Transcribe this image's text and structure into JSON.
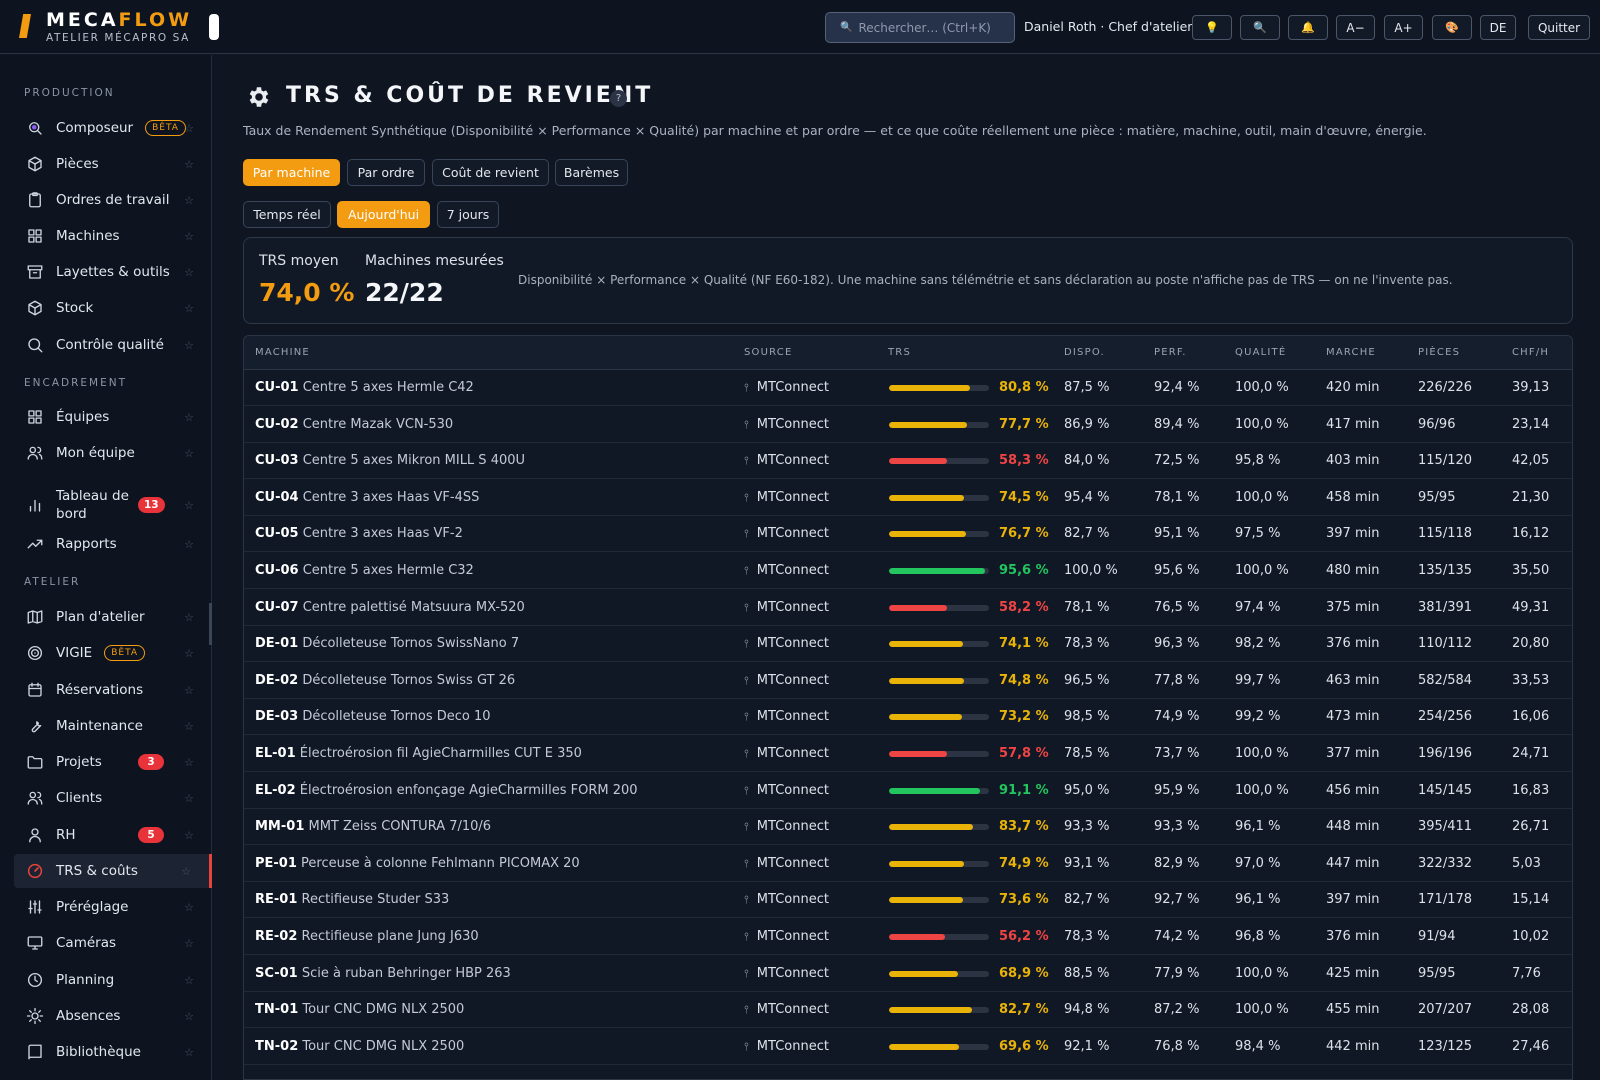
{
  "header": {
    "brand_main": "MECA",
    "brand_accent": "FLOW",
    "brand_sub": "ATELIER MÉCAPRO SA",
    "search_placeholder": "Rechercher…  (Ctrl+K)",
    "user": "Daniel Roth · Chef d'atelier",
    "buttons": [
      {
        "icon": "lightbulb-icon",
        "glyph": "💡"
      },
      {
        "icon": "search-icon",
        "glyph": "🔍"
      },
      {
        "icon": "bell-icon",
        "glyph": "🔔"
      },
      {
        "label": "A−"
      },
      {
        "label": "A+"
      },
      {
        "icon": "palette-icon",
        "glyph": "🎨"
      },
      {
        "label": "DE"
      },
      {
        "label": "Quitter"
      }
    ]
  },
  "sidebar": {
    "sections": [
      "PRODUCTION",
      "ENCADREMENT",
      "ATELIER"
    ],
    "items": [
      {
        "label": "Composeur",
        "icon": "composer-icon",
        "badge_beta": "BÊTA"
      },
      {
        "label": "Pièces",
        "icon": "cube-icon"
      },
      {
        "label": "Ordres de travail",
        "icon": "clipboard-icon"
      },
      {
        "label": "Machines",
        "icon": "grid-icon"
      },
      {
        "label": "Layettes & outils",
        "icon": "archive-icon"
      },
      {
        "label": "Stock",
        "icon": "box-icon"
      },
      {
        "label": "Contrôle qualité",
        "icon": "search-icon"
      },
      {
        "label": "Équipes",
        "icon": "grid-icon"
      },
      {
        "label": "Mon équipe",
        "icon": "users-icon"
      },
      {
        "label": "Tableau de bord",
        "icon": "bar-chart-icon",
        "badge": "13"
      },
      {
        "label": "Rapports",
        "icon": "trending-icon"
      },
      {
        "label": "Plan d'atelier",
        "icon": "map-icon"
      },
      {
        "label": "VIGIE",
        "icon": "target-icon",
        "badge_beta": "BÊTA"
      },
      {
        "label": "Réservations",
        "icon": "calendar-icon"
      },
      {
        "label": "Maintenance",
        "icon": "wrench-icon"
      },
      {
        "label": "Projets",
        "icon": "folder-icon",
        "badge": "3"
      },
      {
        "label": "Clients",
        "icon": "users-icon"
      },
      {
        "label": "RH",
        "icon": "user-icon",
        "badge": "5"
      },
      {
        "label": "TRS & coûts",
        "icon": "gauge-icon",
        "active": true
      },
      {
        "label": "Préréglage",
        "icon": "sliders-icon"
      },
      {
        "label": "Caméras",
        "icon": "monitor-icon"
      },
      {
        "label": "Planning",
        "icon": "clock-icon"
      },
      {
        "label": "Absences",
        "icon": "sun-icon"
      },
      {
        "label": "Bibliothèque",
        "icon": "book-icon"
      }
    ]
  },
  "page": {
    "title": "TRS & COÛT DE REVIENT",
    "help": "?",
    "subtitle": "Taux de Rendement Synthétique (Disponibilité × Performance × Qualité) par machine et par ordre — et ce que coûte réellement une pièce : matière, machine, outil, main d'œuvre, énergie.",
    "view_tabs": [
      "Par machine",
      "Par ordre",
      "Coût de revient",
      "Barèmes"
    ],
    "period_tabs": [
      "Temps réel",
      "Aujourd'hui",
      "7 jours"
    ],
    "summary": {
      "trs_label": "TRS moyen",
      "trs_value": "74,0 %",
      "machines_label": "Machines mesurées",
      "machines_value": "22/22",
      "note": "Disponibilité × Performance × Qualité (NF E60-182). Une machine sans télémétrie et sans déclaration au poste n'affiche pas de TRS — on ne l'invente pas."
    }
  },
  "colors": {
    "accent": "#f39c12",
    "good": "#22c55e",
    "warn": "#eab308",
    "bad": "#ef4444"
  },
  "table": {
    "headers": [
      "MACHINE",
      "SOURCE",
      "TRS",
      "DISPO.",
      "PERF.",
      "QUALITÉ",
      "MARCHE",
      "PIÈCES",
      "CHF/H"
    ],
    "rows": [
      {
        "code": "CU-01",
        "name": "Centre 5 axes Hermle C42",
        "source": "MTConnect",
        "trs": 80.8,
        "trs_text": "80,8 %",
        "level": "warn",
        "dispo": "87,5 %",
        "perf": "92,4 %",
        "qual": "100,0 %",
        "marche": "420 min",
        "pieces": "226/226",
        "chf": "39,13"
      },
      {
        "code": "CU-02",
        "name": "Centre Mazak VCN-530",
        "source": "MTConnect",
        "trs": 77.7,
        "trs_text": "77,7 %",
        "level": "warn",
        "dispo": "86,9 %",
        "perf": "89,4 %",
        "qual": "100,0 %",
        "marche": "417 min",
        "pieces": "96/96",
        "chf": "23,14"
      },
      {
        "code": "CU-03",
        "name": "Centre 5 axes Mikron MILL S 400U",
        "source": "MTConnect",
        "trs": 58.3,
        "trs_text": "58,3 %",
        "level": "bad",
        "dispo": "84,0 %",
        "perf": "72,5 %",
        "qual": "95,8 %",
        "marche": "403 min",
        "pieces": "115/120",
        "chf": "42,05"
      },
      {
        "code": "CU-04",
        "name": "Centre 3 axes Haas VF-4SS",
        "source": "MTConnect",
        "trs": 74.5,
        "trs_text": "74,5 %",
        "level": "warn",
        "dispo": "95,4 %",
        "perf": "78,1 %",
        "qual": "100,0 %",
        "marche": "458 min",
        "pieces": "95/95",
        "chf": "21,30"
      },
      {
        "code": "CU-05",
        "name": "Centre 3 axes Haas VF-2",
        "source": "MTConnect",
        "trs": 76.7,
        "trs_text": "76,7 %",
        "level": "warn",
        "dispo": "82,7 %",
        "perf": "95,1 %",
        "qual": "97,5 %",
        "marche": "397 min",
        "pieces": "115/118",
        "chf": "16,12"
      },
      {
        "code": "CU-06",
        "name": "Centre 5 axes Hermle C32",
        "source": "MTConnect",
        "trs": 95.6,
        "trs_text": "95,6 %",
        "level": "good",
        "dispo": "100,0 %",
        "perf": "95,6 %",
        "qual": "100,0 %",
        "marche": "480 min",
        "pieces": "135/135",
        "chf": "35,50"
      },
      {
        "code": "CU-07",
        "name": "Centre palettisé Matsuura MX-520",
        "source": "MTConnect",
        "trs": 58.2,
        "trs_text": "58,2 %",
        "level": "bad",
        "dispo": "78,1 %",
        "perf": "76,5 %",
        "qual": "97,4 %",
        "marche": "375 min",
        "pieces": "381/391",
        "chf": "49,31"
      },
      {
        "code": "DE-01",
        "name": "Décolleteuse Tornos SwissNano 7",
        "source": "MTConnect",
        "trs": 74.1,
        "trs_text": "74,1 %",
        "level": "warn",
        "dispo": "78,3 %",
        "perf": "96,3 %",
        "qual": "98,2 %",
        "marche": "376 min",
        "pieces": "110/112",
        "chf": "20,80"
      },
      {
        "code": "DE-02",
        "name": "Décolleteuse Tornos Swiss GT 26",
        "source": "MTConnect",
        "trs": 74.8,
        "trs_text": "74,8 %",
        "level": "warn",
        "dispo": "96,5 %",
        "perf": "77,8 %",
        "qual": "99,7 %",
        "marche": "463 min",
        "pieces": "582/584",
        "chf": "33,53"
      },
      {
        "code": "DE-03",
        "name": "Décolleteuse Tornos Deco 10",
        "source": "MTConnect",
        "trs": 73.2,
        "trs_text": "73,2 %",
        "level": "warn",
        "dispo": "98,5 %",
        "perf": "74,9 %",
        "qual": "99,2 %",
        "marche": "473 min",
        "pieces": "254/256",
        "chf": "16,06"
      },
      {
        "code": "EL-01",
        "name": "Électroérosion fil AgieCharmilles CUT E 350",
        "source": "MTConnect",
        "trs": 57.8,
        "trs_text": "57,8 %",
        "level": "bad",
        "dispo": "78,5 %",
        "perf": "73,7 %",
        "qual": "100,0 %",
        "marche": "377 min",
        "pieces": "196/196",
        "chf": "24,71"
      },
      {
        "code": "EL-02",
        "name": "Électroérosion enfonçage AgieCharmilles FORM 200",
        "source": "MTConnect",
        "trs": 91.1,
        "trs_text": "91,1 %",
        "level": "good",
        "dispo": "95,0 %",
        "perf": "95,9 %",
        "qual": "100,0 %",
        "marche": "456 min",
        "pieces": "145/145",
        "chf": "16,83"
      },
      {
        "code": "MM-01",
        "name": "MMT Zeiss CONTURA 7/10/6",
        "source": "MTConnect",
        "trs": 83.7,
        "trs_text": "83,7 %",
        "level": "warn",
        "dispo": "93,3 %",
        "perf": "93,3 %",
        "qual": "96,1 %",
        "marche": "448 min",
        "pieces": "395/411",
        "chf": "26,71"
      },
      {
        "code": "PE-01",
        "name": "Perceuse à colonne Fehlmann PICOMAX 20",
        "source": "MTConnect",
        "trs": 74.9,
        "trs_text": "74,9 %",
        "level": "warn",
        "dispo": "93,1 %",
        "perf": "82,9 %",
        "qual": "97,0 %",
        "marche": "447 min",
        "pieces": "322/332",
        "chf": "5,03"
      },
      {
        "code": "RE-01",
        "name": "Rectifieuse Studer S33",
        "source": "MTConnect",
        "trs": 73.6,
        "trs_text": "73,6 %",
        "level": "warn",
        "dispo": "82,7 %",
        "perf": "92,7 %",
        "qual": "96,1 %",
        "marche": "397 min",
        "pieces": "171/178",
        "chf": "15,14"
      },
      {
        "code": "RE-02",
        "name": "Rectifieuse plane Jung J630",
        "source": "MTConnect",
        "trs": 56.2,
        "trs_text": "56,2 %",
        "level": "bad",
        "dispo": "78,3 %",
        "perf": "74,2 %",
        "qual": "96,8 %",
        "marche": "376 min",
        "pieces": "91/94",
        "chf": "10,02"
      },
      {
        "code": "SC-01",
        "name": "Scie à ruban Behringer HBP 263",
        "source": "MTConnect",
        "trs": 68.9,
        "trs_text": "68,9 %",
        "level": "warn",
        "dispo": "88,5 %",
        "perf": "77,9 %",
        "qual": "100,0 %",
        "marche": "425 min",
        "pieces": "95/95",
        "chf": "7,76"
      },
      {
        "code": "TN-01",
        "name": "Tour CNC DMG NLX 2500",
        "source": "MTConnect",
        "trs": 82.7,
        "trs_text": "82,7 %",
        "level": "warn",
        "dispo": "94,8 %",
        "perf": "87,2 %",
        "qual": "100,0 %",
        "marche": "455 min",
        "pieces": "207/207",
        "chf": "28,08"
      },
      {
        "code": "TN-02",
        "name": "Tour CNC DMG NLX 2500",
        "source": "MTConnect",
        "trs": 69.6,
        "trs_text": "69,6 %",
        "level": "warn",
        "dispo": "92,1 %",
        "perf": "76,8 %",
        "qual": "98,4 %",
        "marche": "442 min",
        "pieces": "123/125",
        "chf": "27,46"
      }
    ]
  }
}
